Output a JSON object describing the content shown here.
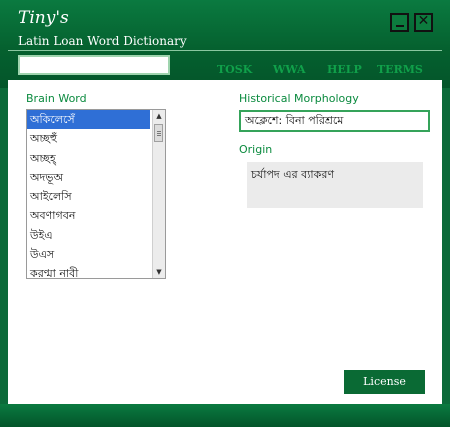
{
  "app": {
    "title": "Tiny's",
    "subtitle": "Latin Loan Word Dictionary"
  },
  "search": {
    "value": "",
    "placeholder": ""
  },
  "nav": [
    {
      "label": "TOSK"
    },
    {
      "label": "WWA"
    },
    {
      "label": "HELP"
    },
    {
      "label": "TERMS"
    }
  ],
  "brain_word": {
    "label": "Brain Word",
    "items": [
      {
        "label": "অকিলেসেঁ",
        "selected": true
      },
      {
        "label": "অচ্ছহুঁ"
      },
      {
        "label": "অচ্ছহ্"
      },
      {
        "label": "অদভূঅ"
      },
      {
        "label": "আইলেসি"
      },
      {
        "label": "অবণাগবন"
      },
      {
        "label": "উইএ"
      },
      {
        "label": "উএস"
      },
      {
        "label": "করণ্মা নাবী"
      }
    ]
  },
  "morphology": {
    "label": "Historical Morphology",
    "value": "অক্লেশে: বিনা পরিশ্রমে"
  },
  "origin": {
    "label": "Origin",
    "value": "চর্যাপদ এর ব্যাকরণ"
  },
  "license_button": "License",
  "colors": {
    "header": "#05612f",
    "accent": "#0a8a3e",
    "selection": "#2f6fd6"
  }
}
